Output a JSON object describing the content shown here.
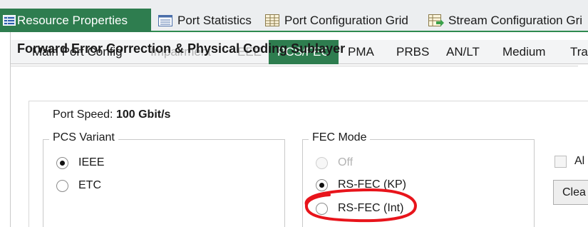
{
  "doc_tabs": [
    {
      "label": "Resource Properties",
      "icon": "properties-icon",
      "active": true
    },
    {
      "label": "Port Statistics",
      "icon": "list-icon",
      "active": false
    },
    {
      "label": "Port Configuration Grid",
      "icon": "grid-icon",
      "active": false
    },
    {
      "label": "Stream Configuration Gri",
      "icon": "stream-grid-icon",
      "active": false
    }
  ],
  "sub_tabs": [
    {
      "label": "Main Port Config",
      "state": "normal"
    },
    {
      "label": "Impairment",
      "state": "disabled"
    },
    {
      "label": "EEE",
      "state": "disabled"
    },
    {
      "label": "PCS/FEC",
      "state": "active"
    },
    {
      "label": "PMA",
      "state": "normal"
    },
    {
      "label": "PRBS",
      "state": "normal"
    },
    {
      "label": "AN/LT",
      "state": "normal"
    },
    {
      "label": "Medium",
      "state": "normal"
    },
    {
      "label": "Tra",
      "state": "normal"
    }
  ],
  "section": {
    "title": "Forward Error Correction & Physical Coding Sublayer"
  },
  "port_speed": {
    "label": "Port Speed:",
    "value": "100 Gbit/s"
  },
  "pcs_variant": {
    "legend": "PCS Variant",
    "options": [
      {
        "label": "IEEE",
        "checked": true,
        "disabled": false
      },
      {
        "label": "ETC",
        "checked": false,
        "disabled": false
      }
    ]
  },
  "fec_mode": {
    "legend": "FEC Mode",
    "options": [
      {
        "label": "Off",
        "checked": false,
        "disabled": true
      },
      {
        "label": "RS-FEC (KP)",
        "checked": true,
        "disabled": false
      },
      {
        "label": "RS-FEC (Int)",
        "checked": false,
        "disabled": false
      }
    ]
  },
  "right_panel": {
    "checkbox_label": "Al",
    "button_label": "Clea"
  },
  "colors": {
    "accent": "#2e7d4f",
    "annotation": "#e8141b"
  }
}
